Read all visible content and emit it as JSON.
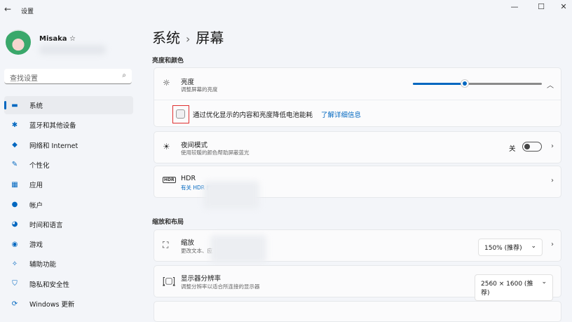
{
  "window": {
    "title": "设置",
    "back": "←",
    "minimize": "—",
    "maximize": "☐",
    "close": "✕"
  },
  "user": {
    "name": "Misaka ☆"
  },
  "search": {
    "placeholder": "查找设置",
    "icon": "⌕"
  },
  "sidebar": {
    "items": [
      {
        "label": "系统",
        "icon": "▬"
      },
      {
        "label": "蓝牙和其他设备",
        "icon": "✱"
      },
      {
        "label": "网络和 Internet",
        "icon": "◆"
      },
      {
        "label": "个性化",
        "icon": "✎"
      },
      {
        "label": "应用",
        "icon": "▦"
      },
      {
        "label": "帐户",
        "icon": "●"
      },
      {
        "label": "时间和语言",
        "icon": "◕"
      },
      {
        "label": "游戏",
        "icon": "◉"
      },
      {
        "label": "辅助功能",
        "icon": "✧"
      },
      {
        "label": "隐私和安全性",
        "icon": "⛉"
      },
      {
        "label": "Windows 更新",
        "icon": "⟳"
      }
    ]
  },
  "breadcrumb": {
    "parent": "系统",
    "sep": "›",
    "current": "屏幕"
  },
  "sections": {
    "brightness_color": "亮度和颜色",
    "scale_layout": "缩放和布局"
  },
  "brightness": {
    "title": "亮度",
    "subtitle": "调整屏幕的亮度",
    "value": 40,
    "checkbox_label": "通过优化显示的内容和亮度降低电池能耗",
    "learn_more": "了解详细信息",
    "checked": false
  },
  "night": {
    "title": "夜间模式",
    "subtitle": "使用较暖的颜色帮助屏蔽蓝光",
    "state": "关"
  },
  "hdr": {
    "title": "HDR",
    "subtitle": "有关 HDR 的"
  },
  "scale": {
    "title": "缩放",
    "subtitle": "更改文本、应",
    "value": "150% (推荐)"
  },
  "resolution": {
    "title": "显示器分辨率",
    "subtitle": "调整分辨率以适合所连接的显示器",
    "value": "2560 × 1600 (推荐)"
  },
  "colors": {
    "accent": "#0067c0",
    "highlight": "#e03030"
  }
}
